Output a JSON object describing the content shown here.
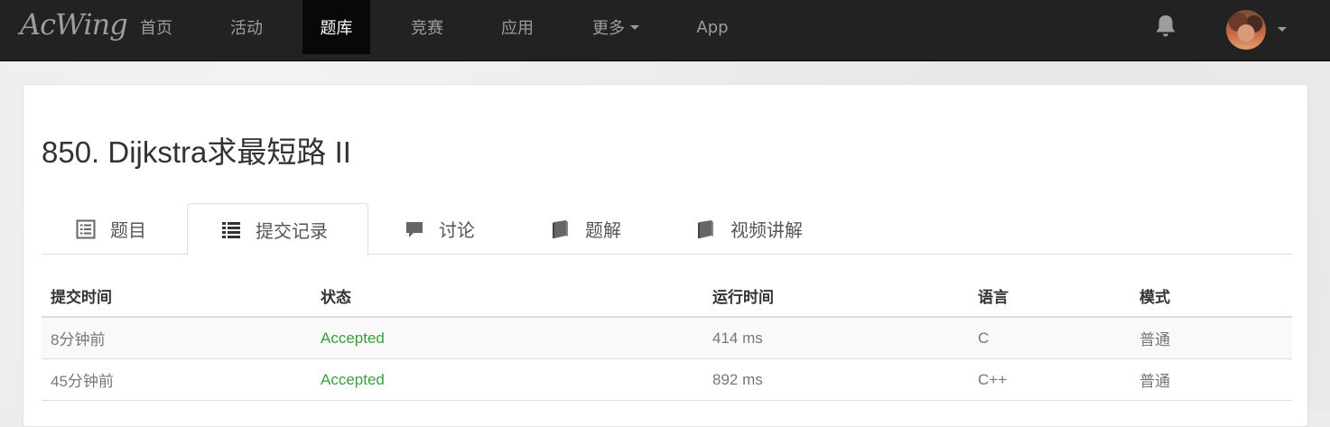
{
  "brand": "AcWing",
  "nav": {
    "items": [
      {
        "label": "首页"
      },
      {
        "label": "活动"
      },
      {
        "label": "题库",
        "active": true
      },
      {
        "label": "竞赛"
      },
      {
        "label": "应用"
      },
      {
        "label": "更多",
        "dropdown": true
      },
      {
        "label": "App"
      }
    ],
    "icons": [
      "bell-icon",
      "user-avatar"
    ]
  },
  "problem": {
    "title": "850. Dijkstra求最短路 II"
  },
  "tabs": [
    {
      "label": "题目",
      "icon": "list-alt-icon"
    },
    {
      "label": "提交记录",
      "icon": "list-icon",
      "active": true
    },
    {
      "label": "讨论",
      "icon": "comment-icon"
    },
    {
      "label": "题解",
      "icon": "book-icon"
    },
    {
      "label": "视频讲解",
      "icon": "book-icon"
    }
  ],
  "submissions": {
    "headers": [
      "提交时间",
      "状态",
      "运行时间",
      "语言",
      "模式"
    ],
    "rows": [
      {
        "time": "8分钟前",
        "status": "Accepted",
        "runtime": "414 ms",
        "language": "C",
        "mode": "普通"
      },
      {
        "time": "45分钟前",
        "status": "Accepted",
        "runtime": "892 ms",
        "language": "C++",
        "mode": "普通"
      }
    ]
  },
  "colors": {
    "navbar": "#222222",
    "accepted": "#3c9d3c",
    "text": "#333333"
  }
}
